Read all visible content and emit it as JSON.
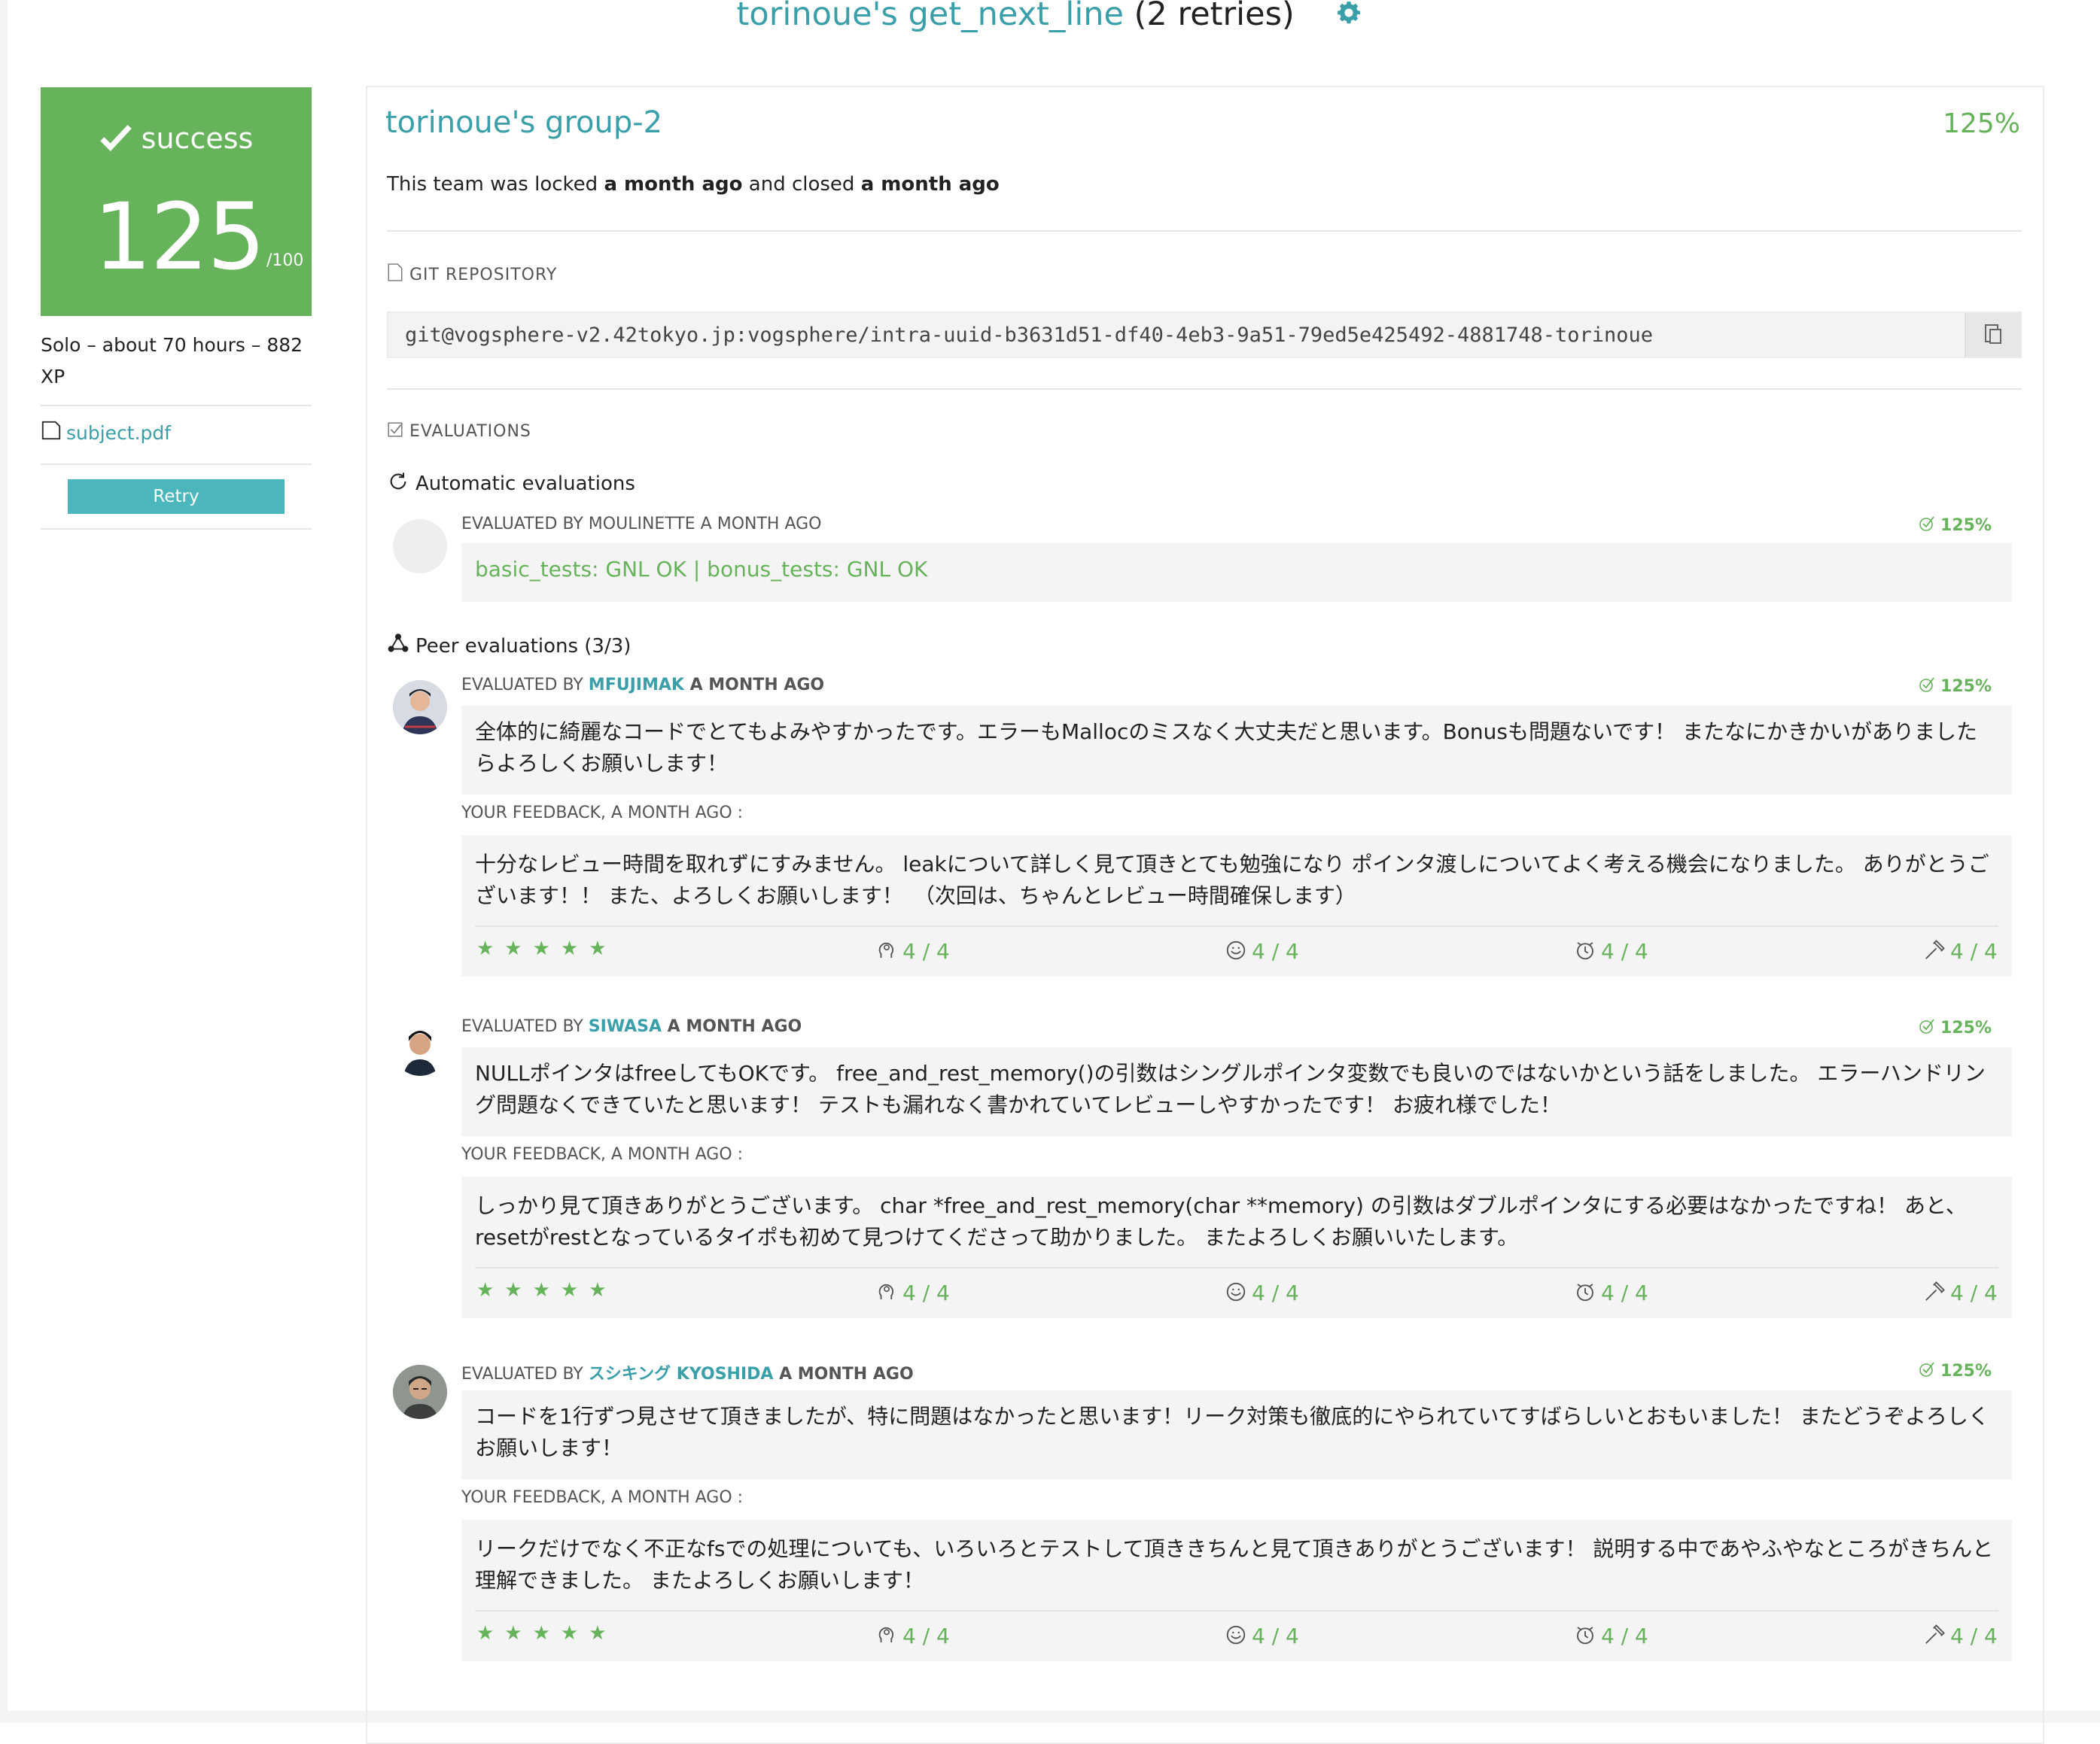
{
  "header": {
    "title_link": "torinoue's get_next_line",
    "title_suffix": "(2 retries)"
  },
  "sidebar": {
    "status": "success",
    "score": "125",
    "max": "/100",
    "meta": "Solo – about 70 hours – 882 XP",
    "subject_link": "subject.pdf",
    "retry_label": "Retry"
  },
  "team": {
    "name": "torinoue's group-2",
    "percent": "125%",
    "locked_pre": "This team was locked ",
    "locked_when": "a month ago",
    "closed_pre": " and closed ",
    "closed_when": "a month ago"
  },
  "git": {
    "section_label": "GIT REPOSITORY",
    "url": "git@vogsphere-v2.42tokyo.jp:vogsphere/intra-uuid-b3631d51-df40-4eb3-9a51-79ed5e425492-4881748-torinoue"
  },
  "evaluations": {
    "section_label": "EVALUATIONS",
    "automatic_label": "Automatic evaluations",
    "auto": {
      "by": "EVALUATED BY MOULINETTE A MONTH AGO",
      "percent": "125%",
      "result": "basic_tests: GNL OK | bonus_tests: GNL OK"
    },
    "peer_label": "Peer evaluations (3/3)",
    "peers": [
      {
        "by_prefix": "EVALUATED BY ",
        "login": "MFUJIMAK",
        "when": " A MONTH AGO",
        "percent": "125%",
        "comment": "全体的に綺麗なコードでとてもよみやすかったです。エラーもMallocのミスなく大丈夫だと思います。Bonusも問題ないです！ またなにかきかいがありましたらよろしくお願いします！",
        "feedback_label": "YOUR FEEDBACK, A MONTH AGO :",
        "feedback": "十分なレビュー時間を取れずにすみません。 leakについて詳しく見て頂きとても勉強になり ポインタ渡しについてよく考える機会になりました。 ありがとうございます！！ また、よろしくお願いします！　（次回は、ちゃんとレビュー時間確保します）",
        "stars": "★★★★★",
        "scores": [
          "4 / 4",
          "4 / 4",
          "4 / 4",
          "4 / 4"
        ]
      },
      {
        "by_prefix": "EVALUATED BY ",
        "login": "SIWASA",
        "when": " A MONTH AGO",
        "percent": "125%",
        "comment": "NULLポインタはfreeしてもOKです。 free_and_rest_memory()の引数はシングルポインタ変数でも良いのではないかという話をしました。 エラーハンドリング問題なくできていたと思います！ テストも漏れなく書かれていてレビューしやすかったです！ お疲れ様でした！",
        "feedback_label": "YOUR FEEDBACK, A MONTH AGO :",
        "feedback": "しっかり見て頂きありがとうございます。 char *free_and_rest_memory(char **memory) の引数はダブルポインタにする必要はなかったですね！ あと、resetがrestとなっているタイポも初めて見つけてくださって助かりました。 またよろしくお願いいたします。",
        "stars": "★★★★★",
        "scores": [
          "4 / 4",
          "4 / 4",
          "4 / 4",
          "4 / 4"
        ]
      },
      {
        "by_prefix": "EVALUATED BY ",
        "login": "スシキング KYOSHIDA",
        "when": " A MONTH AGO",
        "percent": "125%",
        "comment": "コードを1行ずつ見させて頂きましたが、特に問題はなかったと思います！リーク対策も徹底的にやられていてすばらしいとおもいました！ またどうぞよろしくお願いします！",
        "feedback_label": "YOUR FEEDBACK, A MONTH AGO :",
        "feedback": "リークだけでなく不正なfsでの処理についても、いろいろとテストして頂ききちんと見て頂きありがとうございます！ 説明する中であやふやなところがきちんと理解できました。 またよろしくお願いします！",
        "stars": "★★★★★",
        "scores": [
          "4 / 4",
          "4 / 4",
          "4 / 4",
          "4 / 4"
        ]
      }
    ]
  },
  "colors": {
    "accent": "#3a9fa8",
    "success": "#67b35b",
    "retry": "#4cb6bd"
  }
}
